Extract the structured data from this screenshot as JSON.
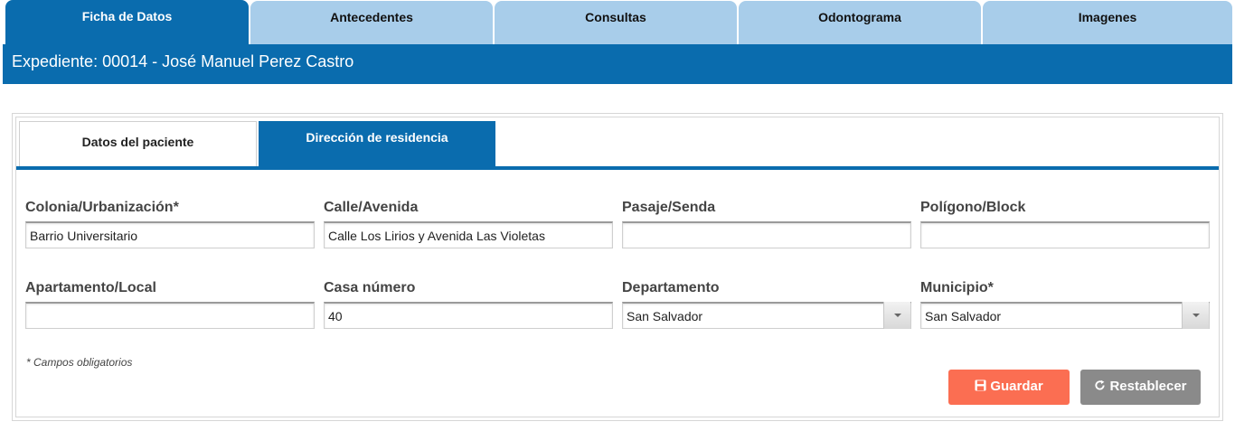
{
  "top_tabs": [
    {
      "label": "Ficha de Datos",
      "active": true
    },
    {
      "label": "Antecedentes",
      "active": false
    },
    {
      "label": "Consultas",
      "active": false
    },
    {
      "label": "Odontograma",
      "active": false
    },
    {
      "label": "Imagenes",
      "active": false
    }
  ],
  "header": {
    "title": "Expediente: 00014 - José Manuel Perez Castro"
  },
  "sub_tabs": [
    {
      "label": "Datos del paciente",
      "active": false
    },
    {
      "label": "Dirección de residencia",
      "active": true
    }
  ],
  "form": {
    "colonia": {
      "label": "Colonia/Urbanización*",
      "value": "Barrio Universitario"
    },
    "calle": {
      "label": "Calle/Avenida",
      "value": "Calle Los Lirios y Avenida Las Violetas"
    },
    "pasaje": {
      "label": "Pasaje/Senda",
      "value": ""
    },
    "poligono": {
      "label": "Polígono/Block",
      "value": ""
    },
    "apartamento": {
      "label": "Apartamento/Local",
      "value": ""
    },
    "casa": {
      "label": "Casa número",
      "value": "40"
    },
    "departamento": {
      "label": "Departamento",
      "value": "San Salvador"
    },
    "municipio": {
      "label": "Municipio*",
      "value": "San Salvador"
    }
  },
  "note": "* Campos obligatorios",
  "buttons": {
    "save_label": "Guardar",
    "save_icon": "floppy-icon",
    "reset_label": "Restablecer",
    "reset_icon": "refresh-icon"
  },
  "colors": {
    "primary": "#0a6cae",
    "tab_inactive": "#a8cdea",
    "save": "#fb6e52",
    "reset": "#8a8a8a"
  }
}
